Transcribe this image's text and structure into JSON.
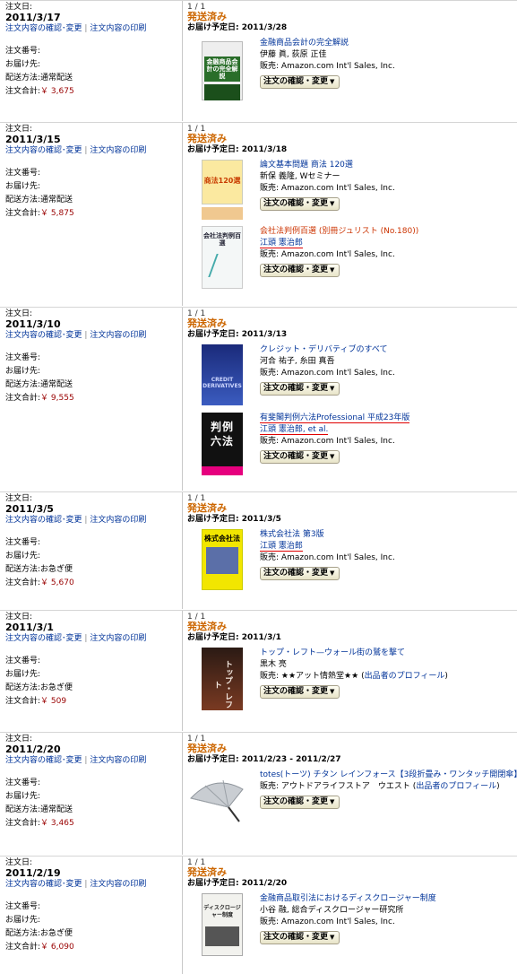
{
  "labels": {
    "order_date": "注文日:",
    "order_number": "注文番号:",
    "ship_to": "お届け先:",
    "ship_method": "配送方法:",
    "order_total": "注文合計:",
    "link_confirm": "注文内容の確認･変更",
    "link_sep": "|",
    "link_print": "注文内容の印刷",
    "delivery_label": "お届け予定日:",
    "seller_prefix": "販売:",
    "action_button": "注文の確認・変更",
    "dropdown_arrow": "▼",
    "profile_link": "出品者のプロフィール",
    "count": "1 / 1"
  },
  "orders": [
    {
      "date": "2011/3/17",
      "method": "通常配送",
      "total": "￥ 3,675",
      "status": "発送済み",
      "delivery": "2011/3/28",
      "items": [
        {
          "title": "金融商品会計の完全解説",
          "author": "伊藤 眞, 荻原 正佳",
          "seller": "Amazon.com Int'l Sales, Inc.",
          "cover": "金融商品会計の完全解説"
        }
      ]
    },
    {
      "date": "2011/3/15",
      "method": "通常配送",
      "total": "￥ 5,875",
      "status": "発送済み",
      "delivery": "2011/3/18",
      "items": [
        {
          "title": "論文基本問題 商法 120選",
          "author": "新保 義隆, Wセミナー",
          "seller": "Amazon.com Int'l Sales, Inc.",
          "cover": "商法120選"
        },
        {
          "title": "会社法判例百選 (別冊ジュリスト (No.180))",
          "author": "江頭 憲治郎",
          "seller": "Amazon.com Int'l Sales, Inc.",
          "cover": "会社法判例百選"
        }
      ]
    },
    {
      "date": "2011/3/10",
      "method": "通常配送",
      "total": "￥ 9,555",
      "status": "発送済み",
      "delivery": "2011/3/13",
      "items": [
        {
          "title": "クレジット・デリバティブのすべて",
          "author": "河合 祐子, 糸田 真吾",
          "seller": "Amazon.com Int'l Sales, Inc.",
          "cover": "CREDIT DERIVATIVES"
        },
        {
          "title": "有斐閣判例六法Professional 平成23年版",
          "author": "江頭 憲治郎, et al.",
          "seller": "Amazon.com Int'l Sales, Inc.",
          "cover": "判例六法"
        }
      ]
    },
    {
      "date": "2011/3/5",
      "method": "お急ぎ便",
      "total": "￥ 5,670",
      "status": "発送済み",
      "delivery": "2011/3/5",
      "items": [
        {
          "title": "株式会社法 第3版",
          "author": "江頭 憲治郎",
          "seller": "Amazon.com Int'l Sales, Inc.",
          "cover": "株式会社法"
        }
      ]
    },
    {
      "date": "2011/3/1",
      "method": "お急ぎ便",
      "total": "￥ 509",
      "status": "発送済み",
      "delivery": "2011/3/1",
      "items": [
        {
          "title": "トップ・レフト—ウォール街の鷲を撃て",
          "author": "黒木 亮",
          "seller": "★★アット情熱堂★★",
          "cover": "トップ・レフト"
        }
      ]
    },
    {
      "date": "2011/2/20",
      "method": "通常配送",
      "total": "￥ 3,465",
      "status": "発送済み",
      "delivery": "2011/2/23 - 2011/2/27",
      "items": [
        {
          "title": "totes(トーツ) チタン レインフォース【3段折畳み・ワンタッチ開閉傘】",
          "author": "",
          "seller": "アウトドアライフストア　ウエスト",
          "cover": ""
        }
      ]
    },
    {
      "date": "2011/2/19",
      "method": "お急ぎ便",
      "total": "￥ 6,090",
      "status": "発送済み",
      "delivery": "2011/2/20",
      "items": [
        {
          "title": "金融商品取引法におけるディスクロージャー制度",
          "author": "小谷 融, 総合ディスクロージャー研究所",
          "seller": "Amazon.com Int'l Sales, Inc.",
          "cover": "ディスクロージャー制度"
        }
      ]
    }
  ]
}
